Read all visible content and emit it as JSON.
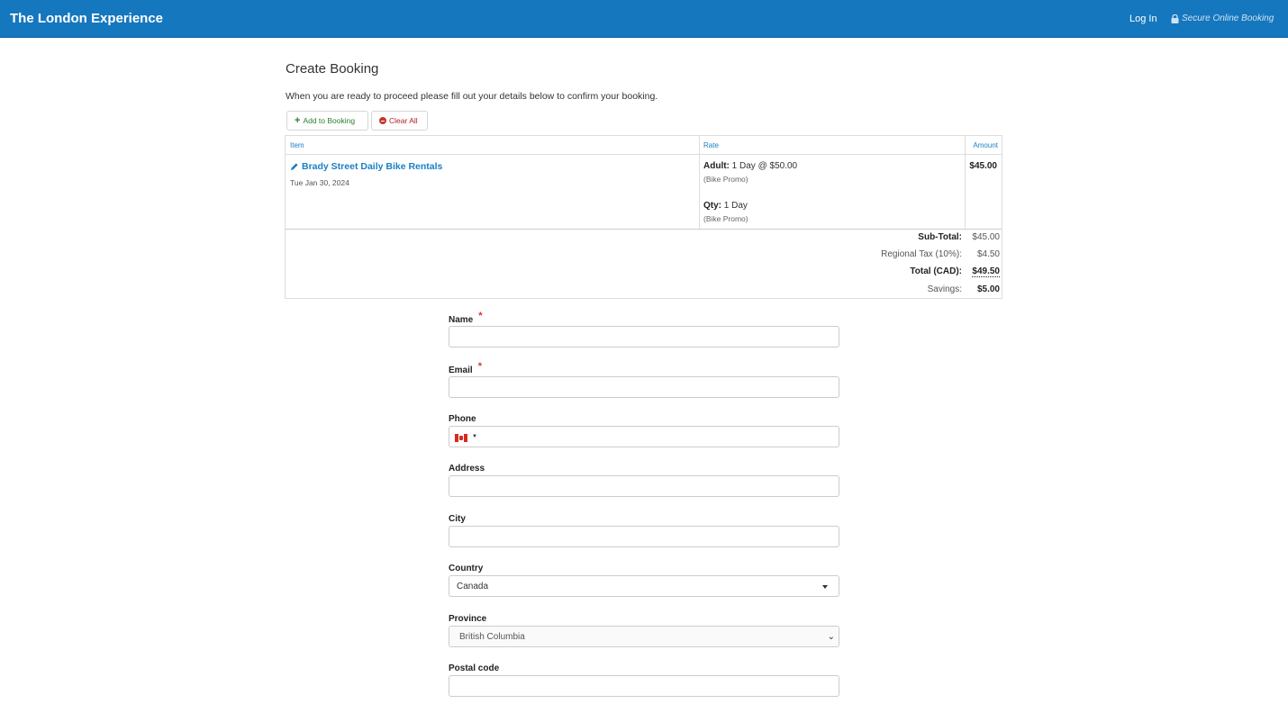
{
  "header": {
    "brand": "The London Experience",
    "login": "Log In",
    "secure": "Secure Online Booking"
  },
  "page": {
    "title": "Create Booking",
    "intro": "When you are ready to proceed please fill out your details below to confirm your booking."
  },
  "actions": {
    "add": "Add to Booking",
    "clear": "Clear All"
  },
  "table": {
    "headers": {
      "item": "Item",
      "rate": "Rate",
      "amount": "Amount"
    },
    "item_name": "Brady Street Daily Bike Rentals",
    "item_date": "Tue Jan 30, 2024",
    "rate_adult_label": "Adult:",
    "rate_adult_value": "1 Day @ $50.00",
    "rate_adult_sub": "(Bike Promo)",
    "rate_qty_label": "Qty:",
    "rate_qty_value": "1 Day",
    "rate_qty_sub": "(Bike Promo)",
    "amount": "$45.00",
    "totals": {
      "subtotal_label": "Sub-Total:",
      "subtotal": "$45.00",
      "tax_label": "Regional Tax (10%):",
      "tax": "$4.50",
      "total_label": "Total (CAD):",
      "total": "$49.50",
      "savings_label": "Savings:",
      "savings": "$5.00"
    }
  },
  "form": {
    "name_label": "Name",
    "email_label": "Email",
    "required_mark": "*",
    "phone_label": "Phone",
    "phone_caret": "▼",
    "address_label": "Address",
    "city_label": "City",
    "country_label": "Country",
    "country_value": "Canada",
    "province_label": "Province",
    "province_value": "British Columbia",
    "province_chevron": "⌄",
    "postal_label": "Postal code"
  },
  "colors": {
    "header_bg": "#1577be",
    "link": "#1a7fc4",
    "required": "#d9342b",
    "add_green": "#2d7d2d",
    "clear_red": "#b32121"
  }
}
